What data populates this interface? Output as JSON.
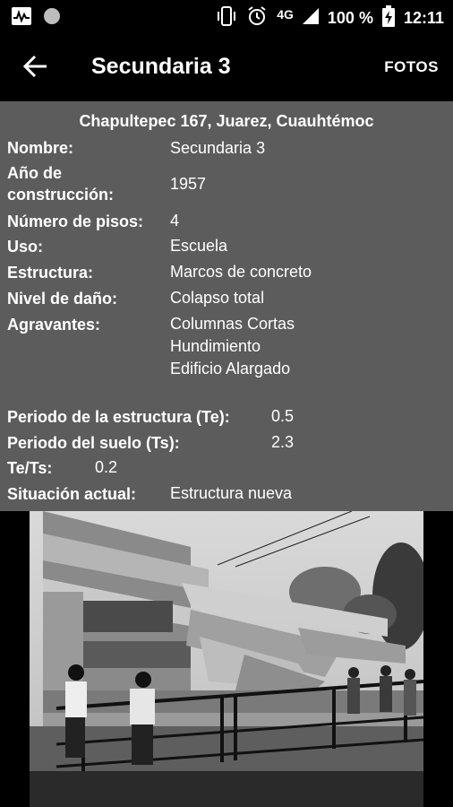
{
  "status_bar": {
    "network": "4G",
    "battery": "100 %",
    "time": "12:11"
  },
  "app_bar": {
    "title": "Secundaria 3",
    "action": "FOTOS"
  },
  "info": {
    "address": "Chapultepec 167, Juarez, Cuauhtémoc",
    "fields": {
      "nombre_label": "Nombre:",
      "nombre_value": "Secundaria 3",
      "ano_label_1": "Año de",
      "ano_label_2": "construcción:",
      "ano_value": "1957",
      "pisos_label": "Número de pisos:",
      "pisos_value": "4",
      "uso_label": "Uso:",
      "uso_value": "Escuela",
      "estructura_label": "Estructura:",
      "estructura_value": "Marcos de concreto",
      "dano_label": "Nivel de daño:",
      "dano_value": "Colapso total",
      "agravantes_label": "Agravantes:",
      "agravantes_values": [
        "Columnas Cortas",
        "Hundimiento",
        "Edificio Alargado"
      ],
      "te_label": "Periodo de la estructura (Te):",
      "te_value": "0.5",
      "ts_label": "Periodo del suelo (Ts):",
      "ts_value": "2.3",
      "tets_label": "Te/Ts:",
      "tets_value": "0.2",
      "situacion_label": "Situación actual:",
      "situacion_value": "Estructura nueva"
    }
  },
  "photo": {
    "icon": "building-collapse-photo"
  },
  "colors": {
    "panel_bg": "#5c5c5c",
    "background": "#000000"
  }
}
